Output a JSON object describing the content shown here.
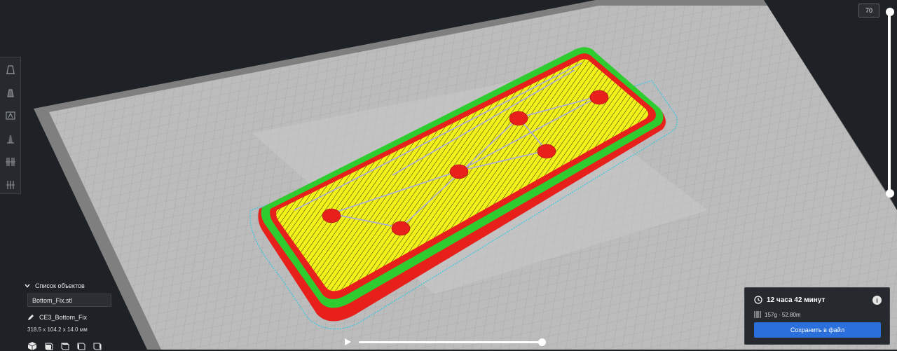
{
  "layer_slider": {
    "value": "70"
  },
  "object_list": {
    "header": "Список объектов",
    "file_name": "Bottom_Fix.stl",
    "object_name": "CE3_Bottom_Fix",
    "dimensions": "318.5 x 104.2 x 14.0 мм"
  },
  "print_info": {
    "time": "12 часа 42 минут",
    "material": "157g · 52.80m",
    "save_label": "Сохранить в файл"
  },
  "colors": {
    "build_plate": "#bdbdbd",
    "wall_outer": "#e8201c",
    "wall_inner": "#2ecc2e",
    "infill": "#f2f21a",
    "skirt": "#3ec8e0",
    "travel": "#a8a8e8",
    "accent": "#2a6fdb"
  },
  "icons": {
    "tools": [
      "print-setup-icon",
      "supports-icon",
      "per-model-settings-icon",
      "mirror-icon",
      "support-blocker-icon",
      "layer-view-icon"
    ],
    "view": [
      "cube-3d-view-icon",
      "front-view-icon",
      "top-view-icon",
      "left-view-icon",
      "right-view-icon"
    ]
  }
}
